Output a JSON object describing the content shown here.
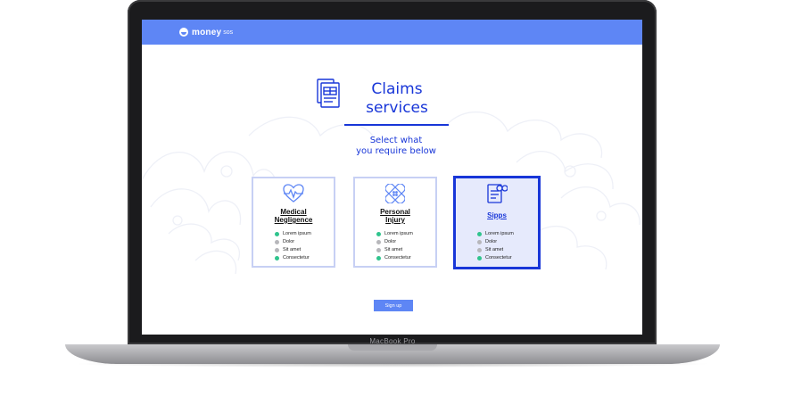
{
  "device": {
    "model_label": "MacBook Pro"
  },
  "app": {
    "logo_name": "money",
    "logo_suffix": "sos",
    "title_line1": "Claims",
    "title_line2": "services",
    "subtitle_line1": "Select what",
    "subtitle_line2": "you require below",
    "signup_label": "Sign up"
  },
  "colors": {
    "brand_blue": "#5e86f5",
    "accent_blue": "#1836d8",
    "check_green": "#2fc48d",
    "disabled_gray": "#b7b7bb"
  },
  "cards": [
    {
      "title_line1": "Medical",
      "title_line2": "Negligence",
      "icon": "heartbeat-icon",
      "selected": false,
      "features": [
        {
          "label": "Lorem ipsum",
          "included": true
        },
        {
          "label": "Dolor",
          "included": false
        },
        {
          "label": "Sit amet",
          "included": false
        },
        {
          "label": "Consectetur",
          "included": true
        }
      ]
    },
    {
      "title_line1": "Personal",
      "title_line2": "Injury",
      "icon": "bandage-icon",
      "selected": false,
      "features": [
        {
          "label": "Lorem ipsum",
          "included": true
        },
        {
          "label": "Dolor",
          "included": false
        },
        {
          "label": "Sit amet",
          "included": false
        },
        {
          "label": "Consectetur",
          "included": true
        }
      ]
    },
    {
      "title_line1": "Sipps",
      "title_line2": "",
      "icon": "pension-document-icon",
      "selected": true,
      "features": [
        {
          "label": "Lorem ipsum",
          "included": true
        },
        {
          "label": "Dolor",
          "included": false
        },
        {
          "label": "Sit amet",
          "included": false
        },
        {
          "label": "Consectetur",
          "included": true
        }
      ]
    }
  ]
}
